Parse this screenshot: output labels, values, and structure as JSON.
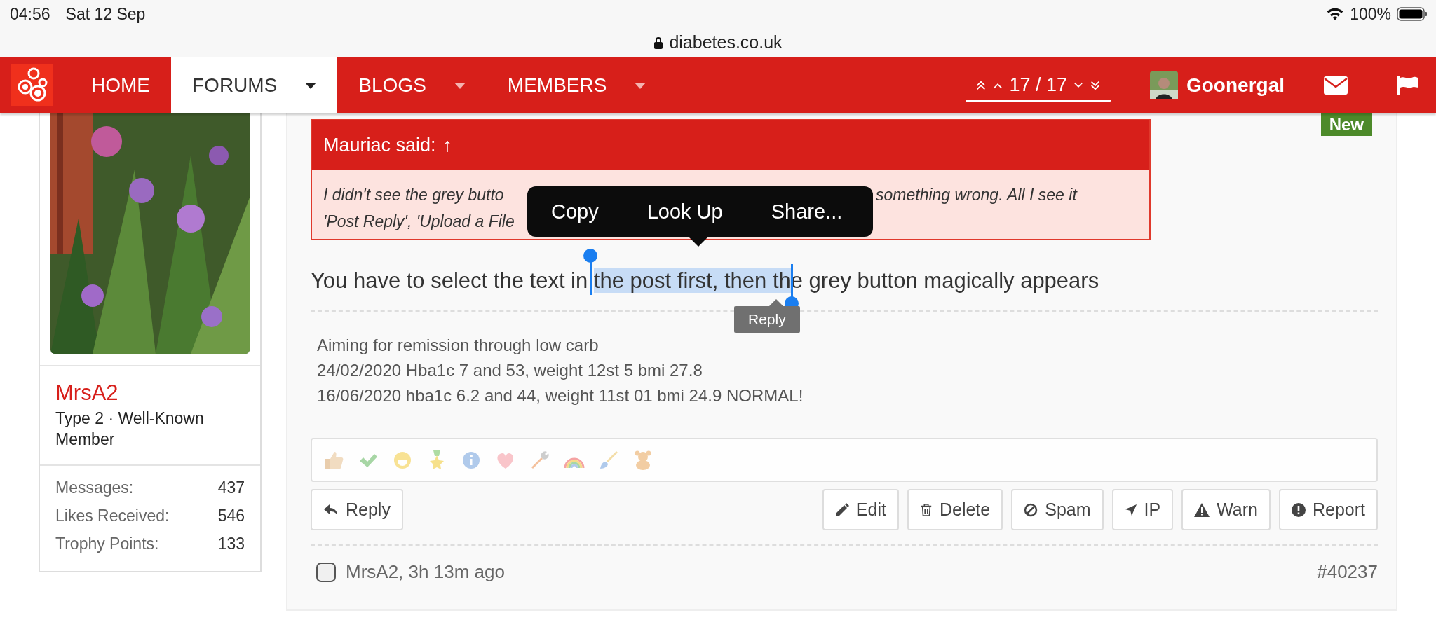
{
  "status_bar": {
    "time": "04:56",
    "date": "Sat 12 Sep",
    "battery": "100%"
  },
  "address_bar": {
    "url": "diabetes.co.uk"
  },
  "nav": {
    "items": [
      {
        "label": "HOME",
        "selected": false,
        "dropdown": false
      },
      {
        "label": "FORUMS",
        "selected": true,
        "dropdown": true
      },
      {
        "label": "BLOGS",
        "selected": false,
        "dropdown": true
      },
      {
        "label": "MEMBERS",
        "selected": false,
        "dropdown": true
      }
    ],
    "pager": "17 / 17",
    "user": "Goonergal"
  },
  "profile": {
    "name": "MrsA2",
    "title": "Type 2 · Well-Known Member",
    "stats": [
      {
        "label": "Messages:",
        "value": "437"
      },
      {
        "label": "Likes Received:",
        "value": "546"
      },
      {
        "label": "Trophy Points:",
        "value": "133"
      }
    ]
  },
  "post": {
    "badge": "New",
    "quote": {
      "author": "Mauriac said:",
      "jump": "↑",
      "lines": [
        [
          "I didn't see the grey butto",
          "something wrong. All I see it"
        ],
        [
          "'Post Reply', 'Upload a File"
        ]
      ]
    },
    "context_menu": [
      "Copy",
      "Look Up",
      "Share..."
    ],
    "body": {
      "before": "You have to select the text in ",
      "selected": "the post first, then th",
      "after": "e grey button magically appears"
    },
    "reply_tooltip": "Reply",
    "signature": [
      "Aiming for remission through low carb",
      "24/02/2020 Hba1c 7 and 53, weight 12st 5 bmi 27.8",
      "16/06/2020 hba1c 6.2 and 44, weight 11st 01 bmi 24.9 NORMAL!"
    ],
    "left_actions": [
      {
        "kind": "reply",
        "label": "Reply"
      }
    ],
    "right_actions": [
      {
        "kind": "edit",
        "label": "Edit"
      },
      {
        "kind": "delete",
        "label": "Delete"
      },
      {
        "kind": "spam",
        "label": "Spam"
      },
      {
        "kind": "ip",
        "label": "IP"
      },
      {
        "kind": "warn",
        "label": "Warn"
      },
      {
        "kind": "report",
        "label": "Report"
      }
    ],
    "footer": {
      "checked": false,
      "author": "MrsA2, 3h 13m ago",
      "number": "#40237"
    }
  }
}
